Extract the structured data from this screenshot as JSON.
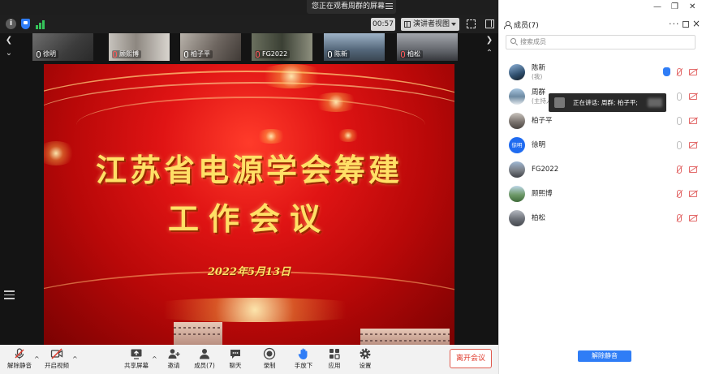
{
  "banner": {
    "text": "您正在观看周群的屏幕"
  },
  "topbar": {
    "timer": "00:57",
    "view_mode": "演讲者视图"
  },
  "thumbnails": [
    {
      "name": "徐明",
      "muted": false
    },
    {
      "name": "顾熙博",
      "muted": true
    },
    {
      "name": "柏子平",
      "muted": false
    },
    {
      "name": "FG2022",
      "muted": true
    },
    {
      "name": "陈新",
      "muted": false
    },
    {
      "name": "柏松",
      "muted": true
    }
  ],
  "slide": {
    "title_line1": "江苏省电源学会筹建",
    "title_line2": "工作会议",
    "date": "2022年5月13日"
  },
  "toolbar": {
    "unmute": "解除静音",
    "start_video": "开启视频",
    "share_screen": "共享屏幕",
    "invite": "邀请",
    "members": "成员(7)",
    "chat": "聊天",
    "record": "录制",
    "hand": "手放下",
    "apps": "应用",
    "settings": "设置",
    "leave": "离开会议"
  },
  "panel": {
    "title": "成员(7)",
    "search_placeholder": "搜索成员",
    "unmute_all": "解除静音",
    "participants": [
      {
        "name": "陈新",
        "sub": "(我)",
        "hand": true,
        "mic": "off",
        "cam": "off"
      },
      {
        "name": "周群",
        "sub": "(主持人)",
        "mic": "on",
        "cam": "off"
      },
      {
        "name": "柏子平",
        "sub": "",
        "mic": "on",
        "cam": "off"
      },
      {
        "name": "徐明",
        "sub": "",
        "avatar_text": "徐明",
        "mic": "on",
        "cam": "off"
      },
      {
        "name": "FG2022",
        "sub": "",
        "mic": "off",
        "cam": "off"
      },
      {
        "name": "顾熙博",
        "sub": "",
        "mic": "off",
        "cam": "off"
      },
      {
        "name": "柏松",
        "sub": "",
        "mic": "off",
        "cam": "off"
      }
    ],
    "speaking_tip": "正在讲话: 周群; 柏子平;"
  },
  "colors": {
    "accent": "#2f7df6",
    "leave": "#e0392b",
    "slide_red": "#d81010",
    "slide_gold": "#ffe066"
  }
}
